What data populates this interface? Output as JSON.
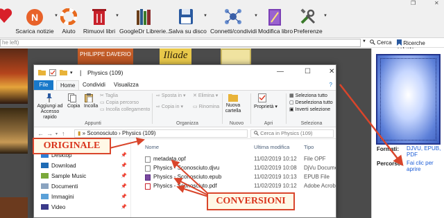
{
  "toolbar": {
    "items": [
      {
        "label": "",
        "icon": "heart-icon"
      },
      {
        "label": "Scarica notizie",
        "icon": "news-download-icon"
      },
      {
        "label": "Aiuto",
        "icon": "lifebuoy-icon"
      },
      {
        "label": "Rimuovi libri",
        "icon": "trash-icon"
      },
      {
        "label": "GoogleDr Librerie...",
        "icon": "library-books-icon"
      },
      {
        "label": "Salva su disco",
        "icon": "floppy-disk-icon"
      },
      {
        "label": "Connetti/condividi",
        "icon": "network-icon"
      },
      {
        "label": "Modifica libro",
        "icon": "edit-book-icon"
      },
      {
        "label": "Preferenze",
        "icon": "tools-icon"
      }
    ]
  },
  "search": {
    "value": "he left)",
    "cerca_label": "Cerca",
    "ricerche_label": "Ricerche salvate"
  },
  "covers": {
    "daverio_title": "PHILIPPE DAVERIO",
    "iliade_title": "Iliade"
  },
  "details": {
    "formati_label": "Formati:",
    "formati_value": "DJVU, EPUB, PDF",
    "percorso_label": "Percorso:",
    "percorso_value": "Fai clic per aprire"
  },
  "explorer": {
    "title": "Physics (109)",
    "tabs": {
      "file": "File",
      "home": "Home",
      "condividi": "Condividi",
      "visualizza": "Visualizza"
    },
    "ribbon": {
      "aggiungi": "Aggiungi ad Accesso rapido",
      "copia": "Copia",
      "incolla": "Incolla",
      "taglia": "Taglia",
      "copia_percorso": "Copia percorso",
      "incolla_collegamento": "Incolla collegamento",
      "group_appunti": "Appunti",
      "sposta_in": "Sposta in",
      "copia_in": "Copia in",
      "elimina": "Elimina",
      "rinomina": "Rinomina",
      "group_organizza": "Organizza",
      "nuova_cartella": "Nuova cartella",
      "group_nuovo": "Nuovo",
      "proprieta": "Proprietà",
      "group_apri": "Apri",
      "seleziona_tutto": "Seleziona tutto",
      "deseleziona_tutto": "Deseleziona tutto",
      "inverti_selezione": "Inverti selezione",
      "group_seleziona": "Seleziona"
    },
    "breadcrumb": "Physics (109)",
    "breadcrumb_parent": "Sconosciuto",
    "search_placeholder": "Cerca in Physics (109)",
    "nav": [
      {
        "label": "Desktop"
      },
      {
        "label": "Download"
      },
      {
        "label": "Sample Music"
      },
      {
        "label": "Documenti"
      },
      {
        "label": "Immagini"
      },
      {
        "label": "Video"
      }
    ],
    "columns": {
      "name": "Nome",
      "modified": "Ultima modifica",
      "type": "Tipo"
    },
    "files": [
      {
        "name": "metadata.opf",
        "date": "11/02/2019 10:12",
        "type": "File OPF"
      },
      {
        "name": "Physics - Sconosciuto.djvu",
        "date": "11/02/2019 10:08",
        "type": "DjVu Documen"
      },
      {
        "name": "Physics - Sconosciuto.epub",
        "date": "11/02/2019 10:13",
        "type": "EPUB File"
      },
      {
        "name": "Physics - Sconosciuto.pdf",
        "date": "11/02/2019 10:12",
        "type": "Adobe Acrobat"
      }
    ]
  },
  "annotations": {
    "originale": "ORIGINALE",
    "conversioni": "CONVERSIONI"
  },
  "colors": {
    "accent": "#1979ca",
    "callout_border": "#d9452b",
    "callout_text": "#d9341c",
    "link": "#1a5bd6"
  }
}
